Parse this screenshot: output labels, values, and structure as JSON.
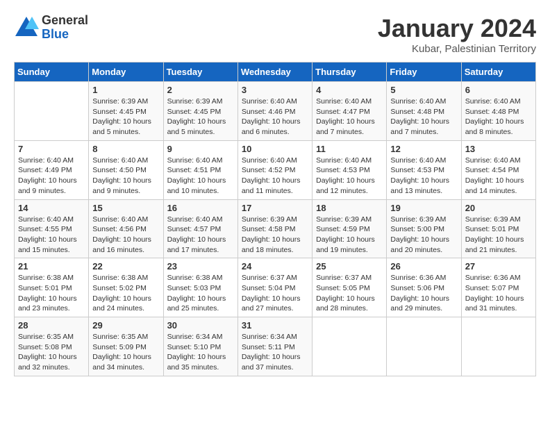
{
  "logo": {
    "general": "General",
    "blue": "Blue"
  },
  "title": "January 2024",
  "subtitle": "Kubar, Palestinian Territory",
  "weekdays": [
    "Sunday",
    "Monday",
    "Tuesday",
    "Wednesday",
    "Thursday",
    "Friday",
    "Saturday"
  ],
  "weeks": [
    [
      {
        "day": "",
        "info": ""
      },
      {
        "day": "1",
        "info": "Sunrise: 6:39 AM\nSunset: 4:45 PM\nDaylight: 10 hours\nand 5 minutes."
      },
      {
        "day": "2",
        "info": "Sunrise: 6:39 AM\nSunset: 4:45 PM\nDaylight: 10 hours\nand 5 minutes."
      },
      {
        "day": "3",
        "info": "Sunrise: 6:40 AM\nSunset: 4:46 PM\nDaylight: 10 hours\nand 6 minutes."
      },
      {
        "day": "4",
        "info": "Sunrise: 6:40 AM\nSunset: 4:47 PM\nDaylight: 10 hours\nand 7 minutes."
      },
      {
        "day": "5",
        "info": "Sunrise: 6:40 AM\nSunset: 4:48 PM\nDaylight: 10 hours\nand 7 minutes."
      },
      {
        "day": "6",
        "info": "Sunrise: 6:40 AM\nSunset: 4:48 PM\nDaylight: 10 hours\nand 8 minutes."
      }
    ],
    [
      {
        "day": "7",
        "info": "Sunrise: 6:40 AM\nSunset: 4:49 PM\nDaylight: 10 hours\nand 9 minutes."
      },
      {
        "day": "8",
        "info": "Sunrise: 6:40 AM\nSunset: 4:50 PM\nDaylight: 10 hours\nand 9 minutes."
      },
      {
        "day": "9",
        "info": "Sunrise: 6:40 AM\nSunset: 4:51 PM\nDaylight: 10 hours\nand 10 minutes."
      },
      {
        "day": "10",
        "info": "Sunrise: 6:40 AM\nSunset: 4:52 PM\nDaylight: 10 hours\nand 11 minutes."
      },
      {
        "day": "11",
        "info": "Sunrise: 6:40 AM\nSunset: 4:53 PM\nDaylight: 10 hours\nand 12 minutes."
      },
      {
        "day": "12",
        "info": "Sunrise: 6:40 AM\nSunset: 4:53 PM\nDaylight: 10 hours\nand 13 minutes."
      },
      {
        "day": "13",
        "info": "Sunrise: 6:40 AM\nSunset: 4:54 PM\nDaylight: 10 hours\nand 14 minutes."
      }
    ],
    [
      {
        "day": "14",
        "info": "Sunrise: 6:40 AM\nSunset: 4:55 PM\nDaylight: 10 hours\nand 15 minutes."
      },
      {
        "day": "15",
        "info": "Sunrise: 6:40 AM\nSunset: 4:56 PM\nDaylight: 10 hours\nand 16 minutes."
      },
      {
        "day": "16",
        "info": "Sunrise: 6:40 AM\nSunset: 4:57 PM\nDaylight: 10 hours\nand 17 minutes."
      },
      {
        "day": "17",
        "info": "Sunrise: 6:39 AM\nSunset: 4:58 PM\nDaylight: 10 hours\nand 18 minutes."
      },
      {
        "day": "18",
        "info": "Sunrise: 6:39 AM\nSunset: 4:59 PM\nDaylight: 10 hours\nand 19 minutes."
      },
      {
        "day": "19",
        "info": "Sunrise: 6:39 AM\nSunset: 5:00 PM\nDaylight: 10 hours\nand 20 minutes."
      },
      {
        "day": "20",
        "info": "Sunrise: 6:39 AM\nSunset: 5:01 PM\nDaylight: 10 hours\nand 21 minutes."
      }
    ],
    [
      {
        "day": "21",
        "info": "Sunrise: 6:38 AM\nSunset: 5:01 PM\nDaylight: 10 hours\nand 23 minutes."
      },
      {
        "day": "22",
        "info": "Sunrise: 6:38 AM\nSunset: 5:02 PM\nDaylight: 10 hours\nand 24 minutes."
      },
      {
        "day": "23",
        "info": "Sunrise: 6:38 AM\nSunset: 5:03 PM\nDaylight: 10 hours\nand 25 minutes."
      },
      {
        "day": "24",
        "info": "Sunrise: 6:37 AM\nSunset: 5:04 PM\nDaylight: 10 hours\nand 27 minutes."
      },
      {
        "day": "25",
        "info": "Sunrise: 6:37 AM\nSunset: 5:05 PM\nDaylight: 10 hours\nand 28 minutes."
      },
      {
        "day": "26",
        "info": "Sunrise: 6:36 AM\nSunset: 5:06 PM\nDaylight: 10 hours\nand 29 minutes."
      },
      {
        "day": "27",
        "info": "Sunrise: 6:36 AM\nSunset: 5:07 PM\nDaylight: 10 hours\nand 31 minutes."
      }
    ],
    [
      {
        "day": "28",
        "info": "Sunrise: 6:35 AM\nSunset: 5:08 PM\nDaylight: 10 hours\nand 32 minutes."
      },
      {
        "day": "29",
        "info": "Sunrise: 6:35 AM\nSunset: 5:09 PM\nDaylight: 10 hours\nand 34 minutes."
      },
      {
        "day": "30",
        "info": "Sunrise: 6:34 AM\nSunset: 5:10 PM\nDaylight: 10 hours\nand 35 minutes."
      },
      {
        "day": "31",
        "info": "Sunrise: 6:34 AM\nSunset: 5:11 PM\nDaylight: 10 hours\nand 37 minutes."
      },
      {
        "day": "",
        "info": ""
      },
      {
        "day": "",
        "info": ""
      },
      {
        "day": "",
        "info": ""
      }
    ]
  ]
}
